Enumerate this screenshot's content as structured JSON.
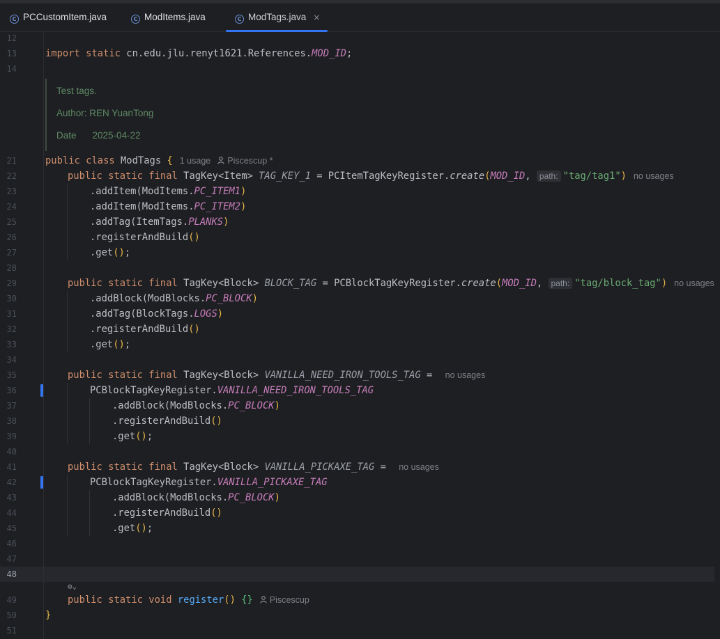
{
  "tabs": [
    {
      "label": "PCCustomItem.java",
      "active": false
    },
    {
      "label": "ModItems.java",
      "active": false
    },
    {
      "label": "ModTags.java",
      "active": true
    }
  ],
  "tab_close": "×",
  "doc": {
    "line1": "Test tags.",
    "line2": "Author: REN YuanTong",
    "line3_key": "Date",
    "line3_val": "2025-04-22"
  },
  "line_numbers": [
    "12",
    "13",
    "14",
    "21",
    "22",
    "23",
    "24",
    "25",
    "26",
    "27",
    "28",
    "29",
    "30",
    "31",
    "32",
    "33",
    "34",
    "35",
    "36",
    "37",
    "38",
    "39",
    "40",
    "41",
    "42",
    "43",
    "44",
    "45",
    "46",
    "47",
    "48",
    "49",
    "50",
    "51"
  ],
  "current_line": "48",
  "code": {
    "import_kw": "import static ",
    "import_path": "cn.edu.jlu.renyt1621.References.",
    "import_field": "MOD_ID",
    "import_end": ";",
    "class_decl": "public class ",
    "class_name": "ModTags ",
    "class_brace": "{",
    "class_usage": "1 usage",
    "class_author": "Piscescup *",
    "tag1_decl": "public static final ",
    "tag1_type": "TagKey<Item> ",
    "tag1_name": "TAG_KEY_1",
    "tag1_eq": " = PCItemTagKeyRegister.",
    "tag1_create": "create",
    "tag1_arg1": "MOD_ID",
    "param_path": "path:",
    "tag1_arg2": "\"tag/tag1\"",
    "no_usages": "no usages",
    "l23_a": ".addItem(ModItems.",
    "l23_b": "PC_ITEM1",
    "l24_a": ".addItem(ModItems.",
    "l24_b": "PC_ITEM2",
    "l25_a": ".addTag(ItemTags.",
    "l25_b": "PLANKS",
    "register_build": ".registerAndBuild",
    "get": ".get",
    "tag2_type": "TagKey<Block> ",
    "tag2_name": "BLOCK_TAG",
    "tag2_eq": " = PCBlockTagKeyRegister.",
    "tag2_arg2": "\"tag/block_tag\"",
    "l30_a": ".addBlock(ModBlocks.",
    "l30_b": "PC_BLOCK",
    "l31_a": ".addTag(BlockTags.",
    "l31_b": "LOGS",
    "tag3_name": "VANILLA_NEED_IRON_TOOLS_TAG",
    "tag3_eq": " = ",
    "reg_class": "PCBlockTagKeyRegister.",
    "tag4_name": "VANILLA_PICKAXE_TAG",
    "method_decl": "public static void ",
    "method_name": "register",
    "method_parens": "()",
    "method_braces": "{}",
    "method_author": "Piscescup",
    "class_close": "}",
    "ai_glyph": "⚙⌄"
  }
}
